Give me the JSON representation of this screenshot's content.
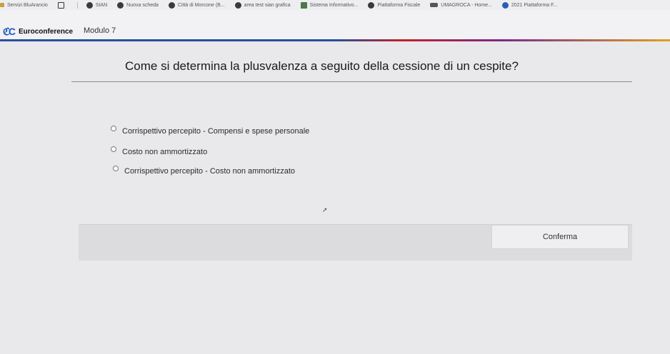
{
  "bookmarks": [
    {
      "label": "Servizi BluArancio",
      "icon": "folder-icon"
    },
    {
      "label": "",
      "icon": "apps-grid-icon"
    },
    {
      "label": "SIAN",
      "icon": "globe-icon"
    },
    {
      "label": "Nuova scheda",
      "icon": "globe-icon"
    },
    {
      "label": "Città di Morcone (B...",
      "icon": "globe-icon"
    },
    {
      "label": "area test sian grafica",
      "icon": "globe-icon"
    },
    {
      "label": "Sistema Informativo...",
      "icon": "document-icon"
    },
    {
      "label": "Piattaforma Fiscale",
      "icon": "globe-icon"
    },
    {
      "label": "UMAGROCA - Home...",
      "icon": "people-icon"
    },
    {
      "label": "2021 Piattaforma F...",
      "icon": "globe-icon"
    }
  ],
  "header": {
    "brand": "Euroconference",
    "logo_mark": "ℭC",
    "module": "Modulo 7"
  },
  "question": "Come si determina la plusvalenza a seguito della cessione di un cespite?",
  "options": [
    "Corrispettivo percepito - Compensi e spese personale",
    "Costo non ammortizzato",
    "Corrispettivo percepito - Costo non ammortizzato"
  ],
  "confirm_label": "Conferma"
}
